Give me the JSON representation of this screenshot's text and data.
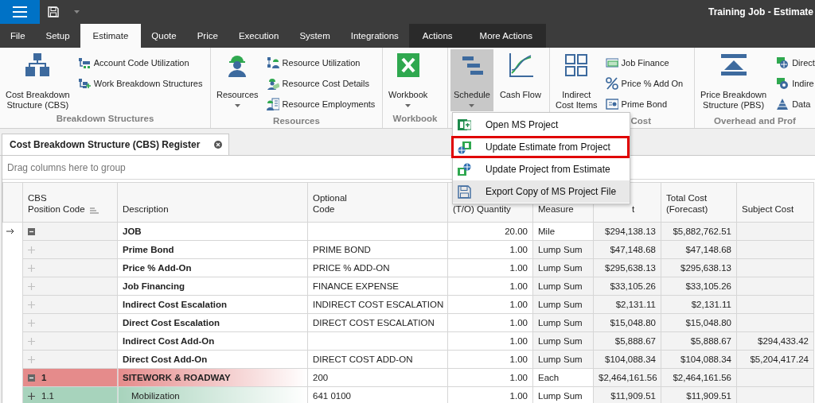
{
  "window": {
    "title": "Training Job - Estimate"
  },
  "ribbon_tabs": [
    {
      "label": "File",
      "selected": false,
      "contextual": false
    },
    {
      "label": "Setup",
      "selected": false,
      "contextual": false
    },
    {
      "label": "Estimate",
      "selected": true,
      "contextual": false
    },
    {
      "label": "Quote",
      "selected": false,
      "contextual": false
    },
    {
      "label": "Price",
      "selected": false,
      "contextual": false
    },
    {
      "label": "Execution",
      "selected": false,
      "contextual": false
    },
    {
      "label": "System",
      "selected": false,
      "contextual": false
    },
    {
      "label": "Integrations",
      "selected": false,
      "contextual": false
    },
    {
      "label": "Actions",
      "selected": false,
      "contextual": true
    },
    {
      "label": "More Actions",
      "selected": false,
      "contextual": true
    }
  ],
  "ribbon_groups": [
    {
      "label": "Breakdown Structures",
      "buttons": [
        {
          "kind": "large",
          "label": "Cost Breakdown\nStructure (CBS)",
          "pressed": false
        },
        {
          "kind": "small",
          "label": "Account Code Utilization"
        },
        {
          "kind": "small",
          "label": "Work Breakdown Structures"
        }
      ]
    },
    {
      "label": "Resources",
      "buttons": [
        {
          "kind": "large",
          "label": "Resources",
          "dropdown": true,
          "pressed": false
        },
        {
          "kind": "small",
          "label": "Resource Utilization"
        },
        {
          "kind": "small",
          "label": "Resource Cost Details"
        },
        {
          "kind": "small",
          "label": "Resource Employments"
        }
      ]
    },
    {
      "label": "Workbook",
      "buttons": [
        {
          "kind": "large",
          "label": "Workbook",
          "dropdown": true,
          "pressed": false
        }
      ]
    },
    {
      "buttons": [
        {
          "kind": "large",
          "label": "Schedule",
          "dropdown": true,
          "pressed": true
        },
        {
          "kind": "large",
          "label": "Cash Flow",
          "dropdown": false,
          "pressed": false
        }
      ]
    },
    {
      "label": "Cost",
      "buttons": [
        {
          "kind": "large",
          "label": "Indirect\nCost Items",
          "pressed": false
        },
        {
          "kind": "small",
          "label": "Job Finance"
        },
        {
          "kind": "small",
          "label": "Price % Add On"
        },
        {
          "kind": "small",
          "label": "Prime Bond"
        }
      ]
    },
    {
      "label": "Overhead and Prof",
      "buttons": [
        {
          "kind": "large",
          "label": "Price Breakdown\nStructure (PBS)",
          "pressed": false
        },
        {
          "kind": "small",
          "label": "Direct"
        },
        {
          "kind": "small",
          "label": "Indire"
        },
        {
          "kind": "small",
          "label": "Data"
        }
      ]
    }
  ],
  "document_tabs": [
    {
      "label": "Cost Breakdown Structure (CBS) Register",
      "selected": true
    }
  ],
  "grid": {
    "group_panel": "Drag columns here to group",
    "columns": [
      {
        "label": "CBS\nPosition Code",
        "sorted": true
      },
      {
        "label": "Description",
        "sorted": false
      },
      {
        "label": "Optional\nCode",
        "sorted": false
      },
      {
        "label": "(T/O) Quantity",
        "sorted": false
      },
      {
        "label": "Measure",
        "sorted": false
      },
      {
        "label": "t",
        "sorted": false
      },
      {
        "label": "Total Cost\n(Forecast)",
        "sorted": false
      },
      {
        "label": "Subject Cost",
        "sorted": false
      }
    ],
    "rows": [
      {
        "kind": "job",
        "current": true,
        "expanded": true,
        "description": "JOB",
        "quantity": "20.00",
        "measure": "Mile",
        "unit_cost": "$294,138.13",
        "total_cost": "$5,882,762.51"
      },
      {
        "kind": "addon",
        "current": false,
        "expanded": false,
        "description": "Prime Bond",
        "optional_code": "PRIME BOND",
        "quantity": "1.00",
        "measure": "Lump Sum",
        "unit_cost": "$47,148.68",
        "total_cost": "$47,148.68"
      },
      {
        "kind": "addon",
        "current": false,
        "expanded": false,
        "description": "Price % Add-On",
        "optional_code": "PRICE % ADD-ON",
        "quantity": "1.00",
        "measure": "Lump Sum",
        "unit_cost": "$295,638.13",
        "total_cost": "$295,638.13"
      },
      {
        "kind": "addon",
        "current": false,
        "expanded": false,
        "description": "Job Financing",
        "optional_code": "FINANCE EXPENSE",
        "quantity": "1.00",
        "measure": "Lump Sum",
        "unit_cost": "$33,105.26",
        "total_cost": "$33,105.26"
      },
      {
        "kind": "addon",
        "current": false,
        "expanded": false,
        "description": "Indirect Cost Escalation",
        "optional_code": "INDIRECT COST ESCALATION",
        "quantity": "1.00",
        "measure": "Lump Sum",
        "unit_cost": "$2,131.11",
        "total_cost": "$2,131.11"
      },
      {
        "kind": "addon",
        "current": false,
        "expanded": false,
        "description": "Direct Cost Escalation",
        "optional_code": "DIRECT COST ESCALATION",
        "quantity": "1.00",
        "measure": "Lump Sum",
        "unit_cost": "$15,048.80",
        "total_cost": "$15,048.80"
      },
      {
        "kind": "addon",
        "current": false,
        "expanded": false,
        "description": "Indirect Cost Add-On",
        "quantity": "1.00",
        "measure": "Lump Sum",
        "unit_cost": "$5,888.67",
        "total_cost": "$5,888.67",
        "subject_cost": "$294,433.42"
      },
      {
        "kind": "addon",
        "current": false,
        "expanded": false,
        "description": "Direct Cost Add-On",
        "optional_code": "DIRECT COST ADD-ON",
        "quantity": "1.00",
        "measure": "Lump Sum",
        "unit_cost": "$104,088.34",
        "total_cost": "$104,088.34",
        "subject_cost": "$5,204,417.24"
      },
      {
        "kind": "section",
        "current": false,
        "expanded": true,
        "code": "1",
        "description": "SITEWORK & ROADWAY",
        "optional_code": "200",
        "quantity": "1.00",
        "measure": "Each",
        "unit_cost": "$2,464,161.56",
        "total_cost": "$2,464,161.56"
      },
      {
        "kind": "item",
        "current": false,
        "expanded": false,
        "code": "1.1",
        "description": "Mobilization",
        "optional_code": "641 0100",
        "quantity": "1.00",
        "measure": "Lump Sum",
        "unit_cost": "$11,909.51",
        "total_cost": "$11,909.51"
      }
    ]
  },
  "schedule_menu": {
    "items": [
      {
        "label": "Open MS Project",
        "outlined": false,
        "hovered": false
      },
      {
        "label": "Update Estimate from Project",
        "outlined": true,
        "hovered": false
      },
      {
        "label": "Update Project from Estimate",
        "outlined": false,
        "hovered": false
      },
      {
        "label": "Export Copy of MS Project File",
        "outlined": false,
        "hovered": true
      }
    ]
  }
}
